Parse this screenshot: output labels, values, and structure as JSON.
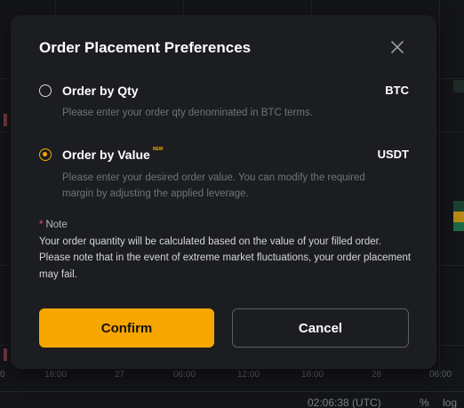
{
  "background": {
    "axis_labels": [
      "0",
      "18:00",
      "27",
      "06:00",
      "12:00",
      "18:00",
      "28",
      "06:00"
    ],
    "status_time": "02:06:38 (UTC)",
    "status_percent": "%",
    "status_log": "log"
  },
  "modal": {
    "title": "Order Placement Preferences",
    "options": [
      {
        "label": "Order by Qty",
        "unit": "BTC",
        "description": "Please enter your order qty denominated in BTC terms.",
        "selected": false,
        "badge": ""
      },
      {
        "label": "Order by Value",
        "unit": "USDT",
        "description": "Please enter your desired order value. You can modify the required margin by adjusting the applied leverage.",
        "selected": true,
        "badge": "NEW"
      }
    ],
    "note": {
      "asterisk": "*",
      "title": "Note",
      "body": "Your order quantity will be calculated based on the value of your filled order. Please note that in the event of extreme market fluctuations, your order placement may fail."
    },
    "confirm_label": "Confirm",
    "cancel_label": "Cancel"
  },
  "colors": {
    "accent": "#f7a600",
    "modal_bg": "#1c1d21",
    "asterisk": "#f6465d"
  }
}
